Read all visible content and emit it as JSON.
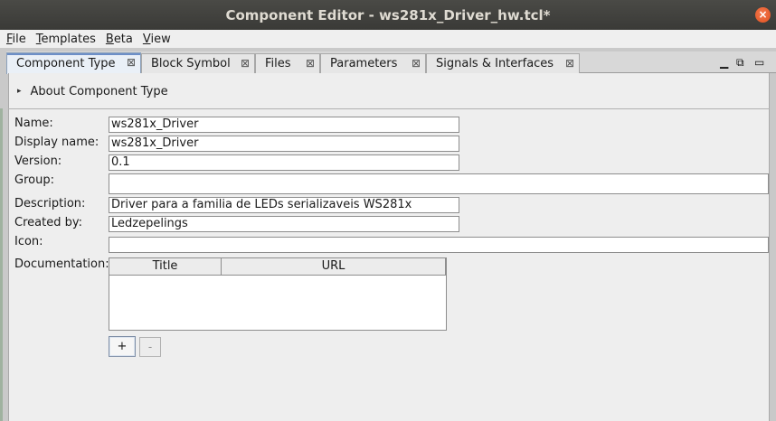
{
  "window": {
    "title": "Component Editor - ws281x_Driver_hw.tcl*",
    "close_glyph": "×"
  },
  "menu": [
    {
      "u": "F",
      "rest": "ile"
    },
    {
      "u": "T",
      "rest": "emplates"
    },
    {
      "u": "B",
      "rest": "eta"
    },
    {
      "u": "V",
      "rest": "iew"
    }
  ],
  "tabs": [
    {
      "label": "Component Type",
      "active": true
    },
    {
      "label": "Block Symbol",
      "active": false
    },
    {
      "label": "Files",
      "active": false
    },
    {
      "label": "Parameters",
      "active": false
    },
    {
      "label": "Signals & Interfaces",
      "active": false
    }
  ],
  "tab_close_glyph": "⊠",
  "window_controls": {
    "minimize": "▁",
    "restore": "⧉",
    "maximize": "▭"
  },
  "about": {
    "label": "About Component Type",
    "arrow": "▸"
  },
  "form": {
    "name": {
      "label": "Name:",
      "value": "ws281x_Driver"
    },
    "display_name": {
      "label": "Display name:",
      "value": "ws281x_Driver"
    },
    "version": {
      "label": "Version:",
      "value": "0.1"
    },
    "group": {
      "label": "Group:",
      "value": ""
    },
    "description": {
      "label": "Description:",
      "value": "Driver para a familia de LEDs serializaveis WS281x"
    },
    "created_by": {
      "label": "Created by:",
      "value": "Ledzepelings"
    },
    "icon": {
      "label": "Icon:",
      "value": ""
    },
    "documentation": {
      "label": "Documentation:",
      "columns": [
        "Title",
        "URL"
      ]
    }
  },
  "buttons": {
    "add": "+",
    "remove": "-"
  }
}
